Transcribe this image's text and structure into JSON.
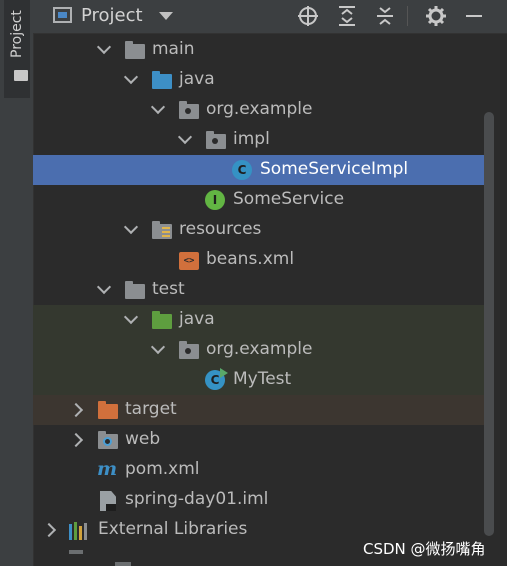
{
  "side_panel": {
    "tab_label": "Project"
  },
  "header": {
    "title": "Project",
    "icons": [
      "locate-icon",
      "expand-all-icon",
      "collapse-all-icon",
      "settings-icon",
      "hide-icon"
    ]
  },
  "tree": {
    "items": [
      {
        "label": "main",
        "icon": "folder-icon",
        "expanded": true
      },
      {
        "label": "java",
        "icon": "source-folder-icon",
        "expanded": true
      },
      {
        "label": "org.example",
        "icon": "package-icon",
        "expanded": true
      },
      {
        "label": "impl",
        "icon": "package-icon",
        "expanded": true
      },
      {
        "label": "SomeServiceImpl",
        "icon": "class-icon",
        "selected": true,
        "badge": "C"
      },
      {
        "label": "SomeService",
        "icon": "interface-icon",
        "badge": "I"
      },
      {
        "label": "resources",
        "icon": "resources-folder-icon",
        "expanded": true
      },
      {
        "label": "beans.xml",
        "icon": "xml-file-icon",
        "badge": "<>"
      },
      {
        "label": "test",
        "icon": "folder-icon",
        "expanded": true
      },
      {
        "label": "java",
        "icon": "test-source-folder-icon",
        "expanded": true
      },
      {
        "label": "org.example",
        "icon": "package-icon",
        "expanded": true
      },
      {
        "label": "MyTest",
        "icon": "test-class-icon",
        "badge": "C"
      },
      {
        "label": "target",
        "icon": "excluded-folder-icon",
        "expanded": false
      },
      {
        "label": "web",
        "icon": "web-folder-icon",
        "expanded": false
      },
      {
        "label": "pom.xml",
        "icon": "maven-icon",
        "badge": "m"
      },
      {
        "label": "spring-day01.iml",
        "icon": "iml-file-icon"
      },
      {
        "label": "External Libraries",
        "icon": "libraries-icon",
        "expanded": false
      }
    ]
  },
  "watermark": "CSDN @微扬嘴角",
  "colors": {
    "selection": "#4b6eaf",
    "test_row": "#34382f",
    "excluded_row": "#3c3630",
    "accent_blue": "#3592c4",
    "accent_green": "#62b543",
    "accent_orange": "#d1703c"
  }
}
